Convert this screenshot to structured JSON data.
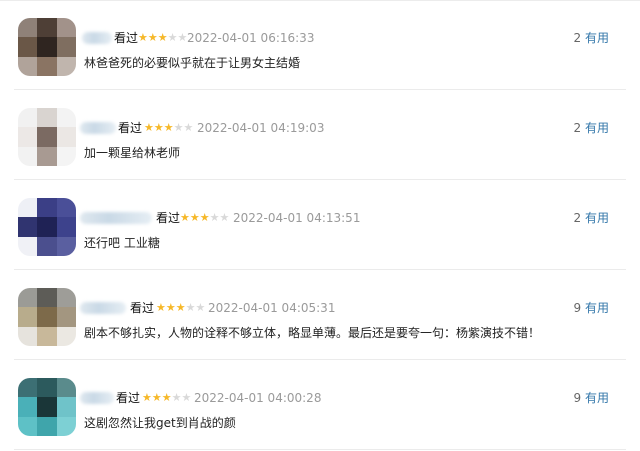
{
  "reviews": [
    {
      "seen_label": "看过",
      "rating": 3,
      "timestamp": "2022-04-01 06:16:33",
      "helpful_count": "2",
      "helpful_label": "有用",
      "comment": "林爸爸死的必要似乎就在于让男女主结婚"
    },
    {
      "seen_label": "看过",
      "rating": 3,
      "timestamp": "2022-04-01 04:19:03",
      "helpful_count": "2",
      "helpful_label": "有用",
      "comment": "加一颗星给林老师"
    },
    {
      "seen_label": "看过",
      "rating": 3,
      "timestamp": "2022-04-01 04:13:51",
      "helpful_count": "2",
      "helpful_label": "有用",
      "comment": "还行吧 工业糖"
    },
    {
      "seen_label": "看过",
      "rating": 3,
      "timestamp": "2022-04-01 04:05:31",
      "helpful_count": "9",
      "helpful_label": "有用",
      "comment": "剧本不够扎实，人物的诠释不够立体，略显单薄。最后还是要夸一句：杨紫演技不错！"
    },
    {
      "seen_label": "看过",
      "rating": 3,
      "timestamp": "2022-04-01 04:00:28",
      "helpful_count": "9",
      "helpful_label": "有用",
      "comment": "这剧忽然让我get到肖战的颜"
    }
  ],
  "colors": {
    "star_on": "#f6b829",
    "star_off": "#d9d9d9",
    "timestamp": "#9a9a9a",
    "helpful_link": "#3377aa",
    "divider": "#ebebeb"
  }
}
